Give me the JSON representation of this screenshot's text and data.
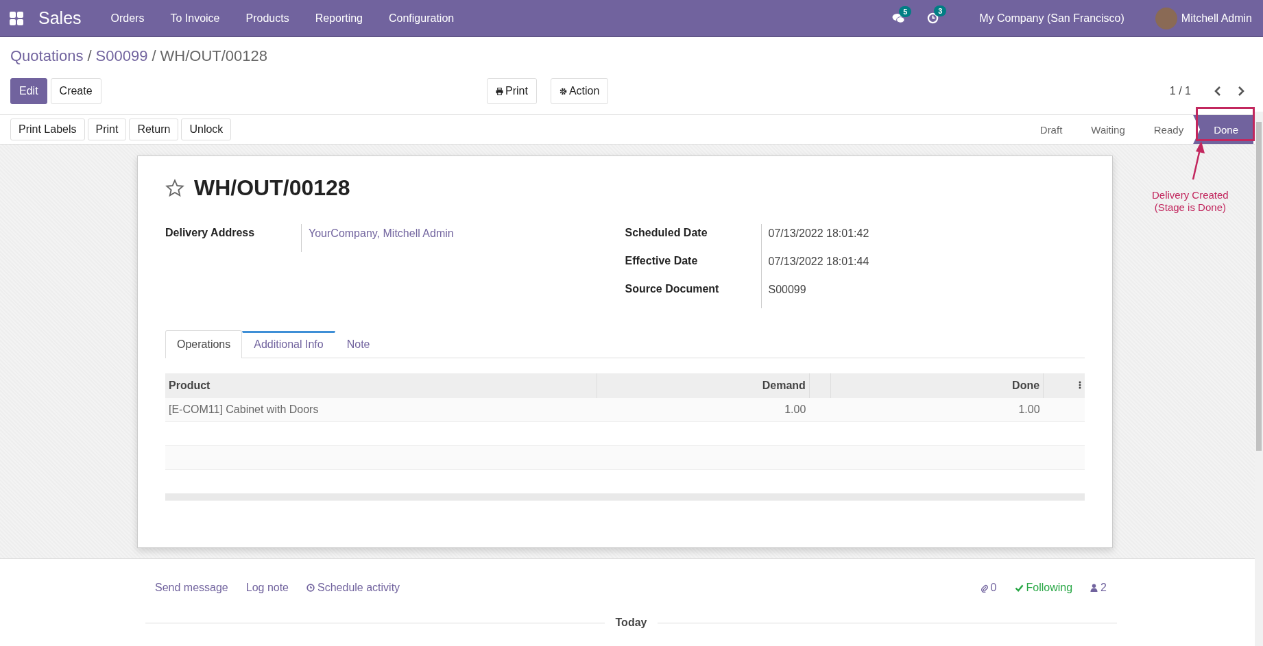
{
  "navbar": {
    "app": "Sales",
    "menu": [
      "Orders",
      "To Invoice",
      "Products",
      "Reporting",
      "Configuration"
    ],
    "messages_badge": "5",
    "activities_badge": "3",
    "company": "My Company (San Francisco)",
    "user": "Mitchell Admin"
  },
  "breadcrumb_separator": "/",
  "breadcrumb": [
    {
      "label": "Quotations",
      "link": true
    },
    {
      "label": "S00099",
      "link": true
    },
    {
      "label": "WH/OUT/00128",
      "link": false
    }
  ],
  "control_buttons": [
    {
      "label": "Edit",
      "primary": true
    },
    {
      "label": "Create",
      "primary": false
    }
  ],
  "print_button": "Print",
  "action_button": "Action",
  "pager": "1 / 1",
  "header_buttons": [
    "Print Labels",
    "Print",
    "Return",
    "Unlock"
  ],
  "stages": [
    {
      "label": "Draft",
      "selected": false
    },
    {
      "label": "Waiting",
      "selected": false
    },
    {
      "label": "Ready",
      "selected": false
    },
    {
      "label": "Done",
      "selected": true
    }
  ],
  "annotation": {
    "lines": [
      "Delivery Created",
      "(Stage is Done)"
    ]
  },
  "record": {
    "title": "WH/OUT/00128",
    "starred": false,
    "left_fields": [
      {
        "label": "Delivery Address",
        "value": "YourCompany, Mitchell Admin",
        "link": true
      }
    ],
    "right_fields": [
      {
        "label": "Scheduled Date",
        "value": "07/13/2022 18:01:42",
        "link": false
      },
      {
        "label": "Effective Date",
        "value": "07/13/2022 18:01:44",
        "link": false
      },
      {
        "label": "Source Document",
        "value": "S00099",
        "link": false
      }
    ]
  },
  "tabs": [
    {
      "label": "Operations",
      "selected": true,
      "focus_bar": false
    },
    {
      "label": "Additional Info",
      "selected": false,
      "focus_bar": true
    },
    {
      "label": "Note",
      "selected": false,
      "focus_bar": false
    }
  ],
  "table": {
    "columns": [
      "Product",
      "Demand",
      "Done"
    ],
    "rows": [
      {
        "product": "[E-COM11] Cabinet with Doors",
        "demand": "1.00",
        "done": "1.00"
      }
    ]
  },
  "chatter": {
    "actions": [
      "Send message",
      "Log note",
      "Schedule activity"
    ],
    "attachments": "0",
    "following": "Following",
    "followers": "2",
    "date_separator": "Today"
  }
}
